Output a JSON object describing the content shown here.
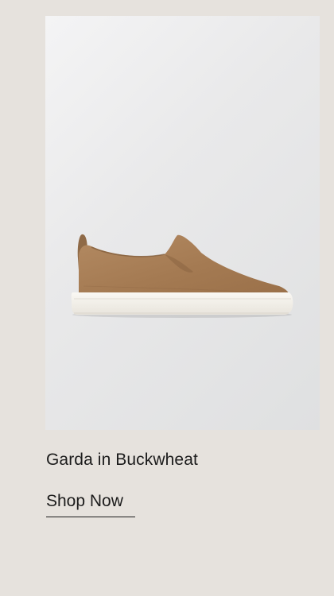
{
  "product": {
    "title": "Garda in Buckwheat",
    "image_icon": "slip-on-sneaker-image",
    "colors": {
      "upper": "#a47a52",
      "sole": "#f3f0ea",
      "background": "#e6e2dd"
    }
  },
  "cta": {
    "label": "Shop Now"
  }
}
